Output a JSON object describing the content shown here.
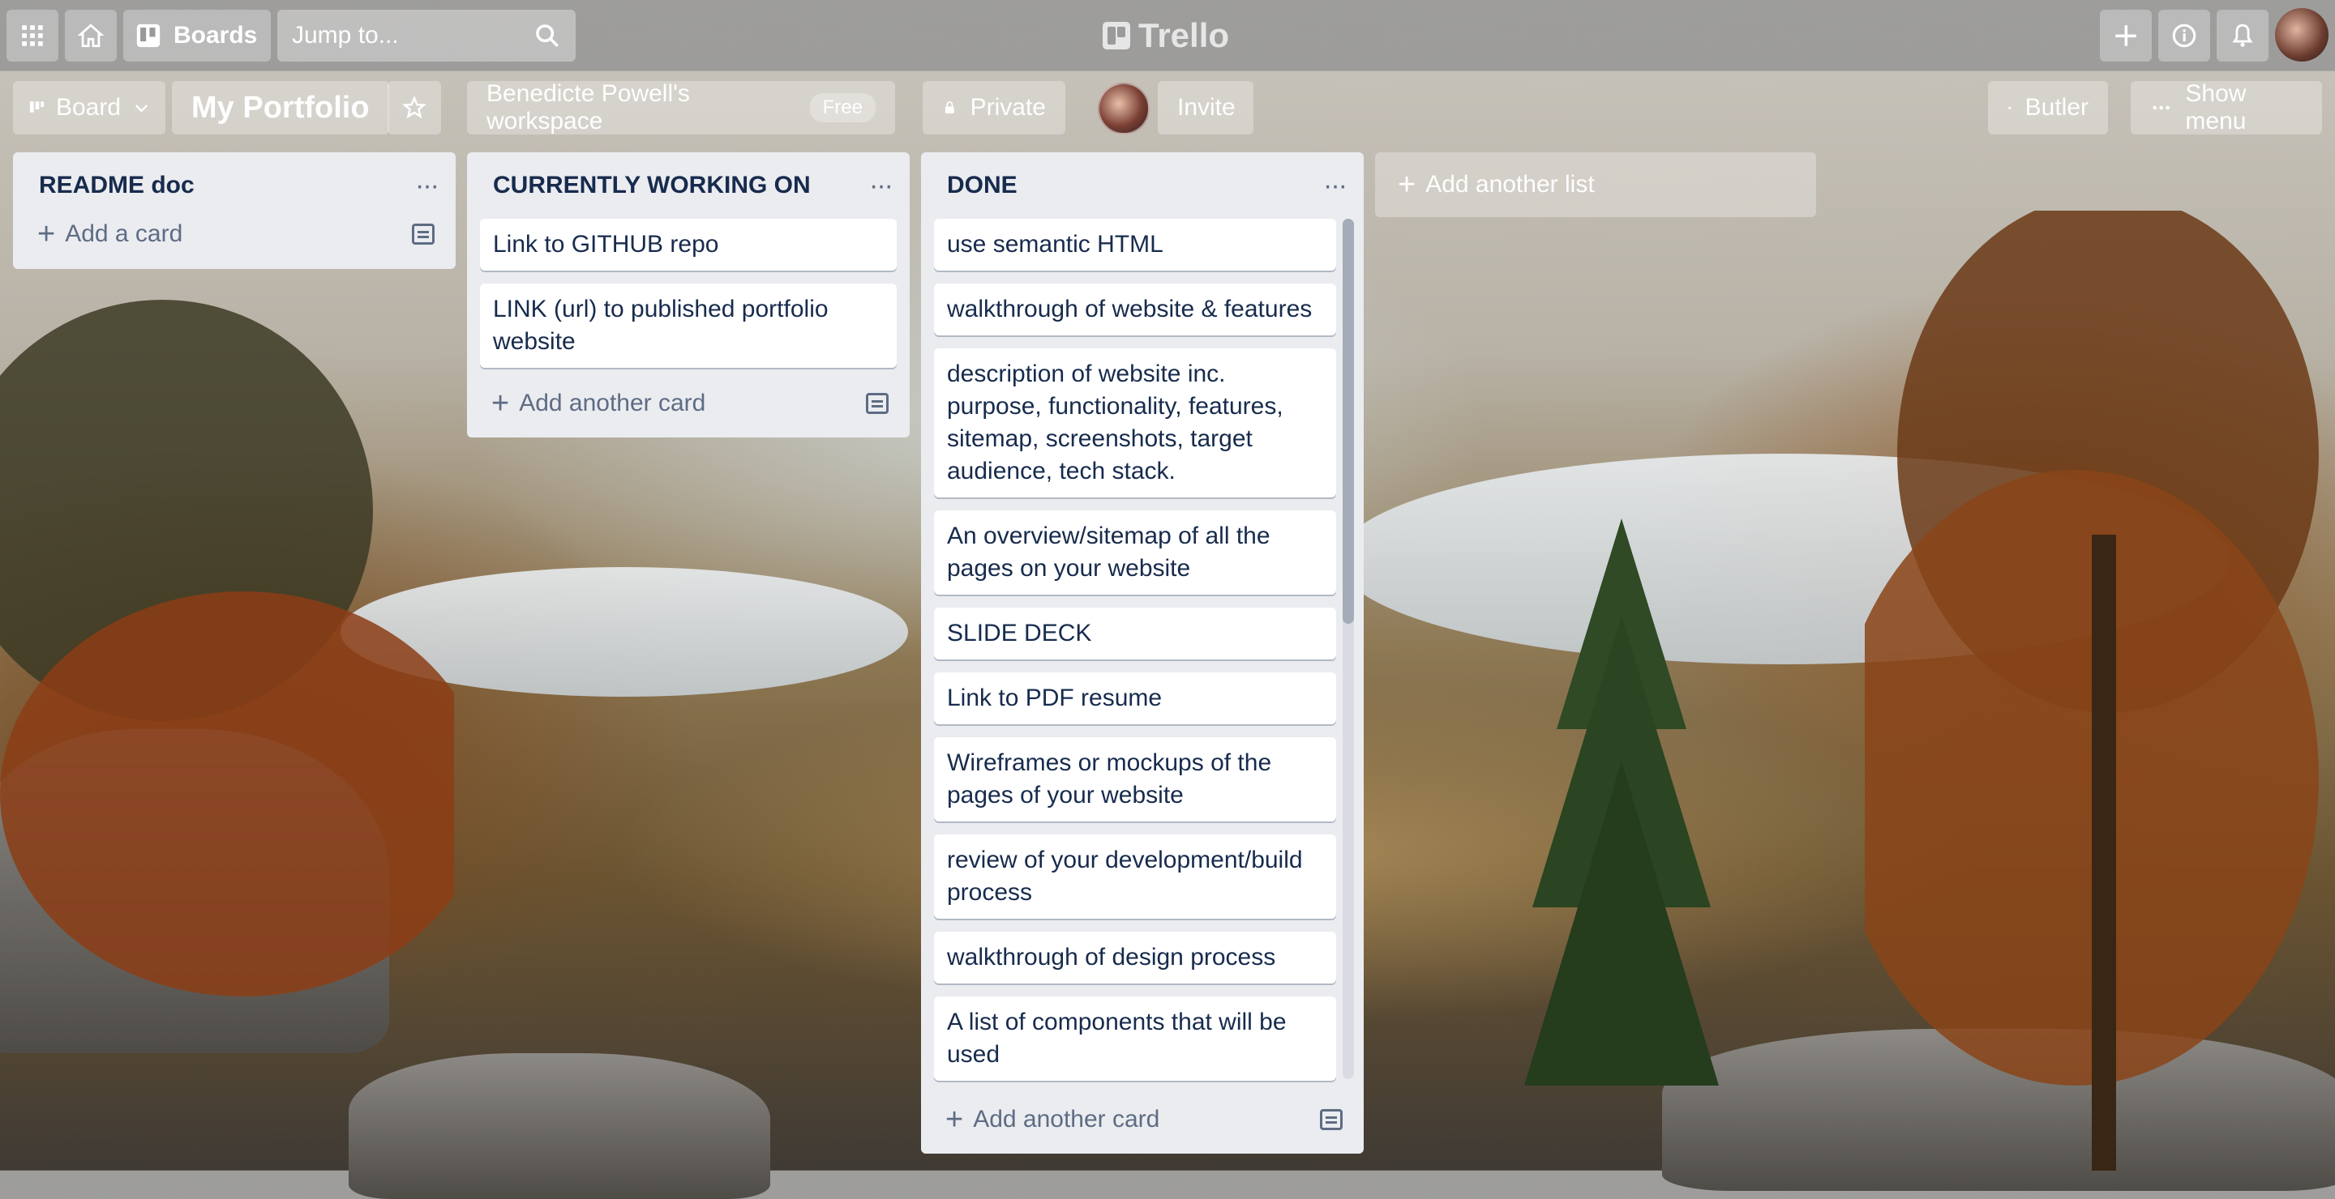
{
  "header": {
    "boards_label": "Boards",
    "search_placeholder": "Jump to...",
    "logo_text": "Trello"
  },
  "board_header": {
    "view_label": "Board",
    "title": "My Portfolio",
    "workspace_label": "Benedicte Powell's workspace",
    "workspace_badge": "Free",
    "visibility_label": "Private",
    "invite_label": "Invite",
    "butler_label": "Butler",
    "show_menu_label": "Show menu"
  },
  "lists": [
    {
      "title": "README doc",
      "cards": [],
      "add_label": "Add a card"
    },
    {
      "title": "CURRENTLY WORKING ON",
      "cards": [
        "Link to GITHUB repo",
        "LINK (url) to published portfolio website"
      ],
      "add_label": "Add another card"
    },
    {
      "title": "DONE",
      "cards": [
        "use semantic HTML",
        "walkthrough of website & features",
        "description of website inc. purpose, functionality, features, sitemap, screenshots, target audience, tech stack.",
        "An overview/sitemap of all the pages on your website",
        "SLIDE DECK",
        "Link to PDF resume",
        "Wireframes or mockups of the pages of your website",
        "review of your development/build process",
        "walkthrough of design process",
        "A list of components that will be used"
      ],
      "add_label": "Add another card"
    }
  ],
  "add_list_label": "Add another list",
  "icons": {
    "apps": "grid-icon",
    "home": "home-icon",
    "boards": "board-icon",
    "search": "search-icon",
    "create": "plus-icon",
    "info": "info-icon",
    "notifications": "bell-icon",
    "star": "star-icon",
    "lock": "lock-icon",
    "butler": "butler-icon",
    "menu": "more-icon"
  }
}
